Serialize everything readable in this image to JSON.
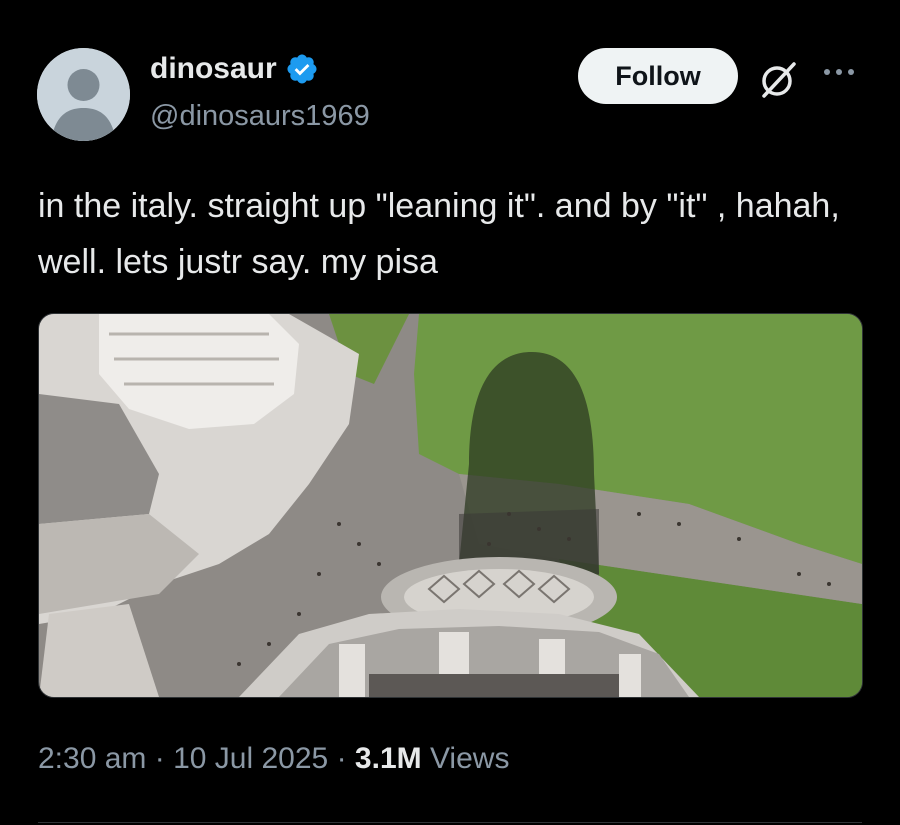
{
  "author": {
    "display_name": "dinosaur",
    "handle": "@dinosaurs1969",
    "verified": true
  },
  "actions": {
    "follow_label": "Follow",
    "grok_icon": "grok-icon",
    "more_icon": "more-dots-icon"
  },
  "tweet": {
    "text": "in the italy. straight up \"leaning it\". and by \"it\" , hahah, well. lets justr say. my pisa"
  },
  "media": {
    "description_icon": "photo"
  },
  "meta": {
    "time": "2:30 am",
    "date": "10 Jul 2025",
    "views_count": "3.1M",
    "views_label": "Views",
    "separator": "·"
  },
  "colors": {
    "background": "#000000",
    "text": "#e7e9ea",
    "secondary_text": "#8b98a5",
    "verified_badge": "#1d9bf0",
    "follow_bg": "#eff3f4"
  }
}
